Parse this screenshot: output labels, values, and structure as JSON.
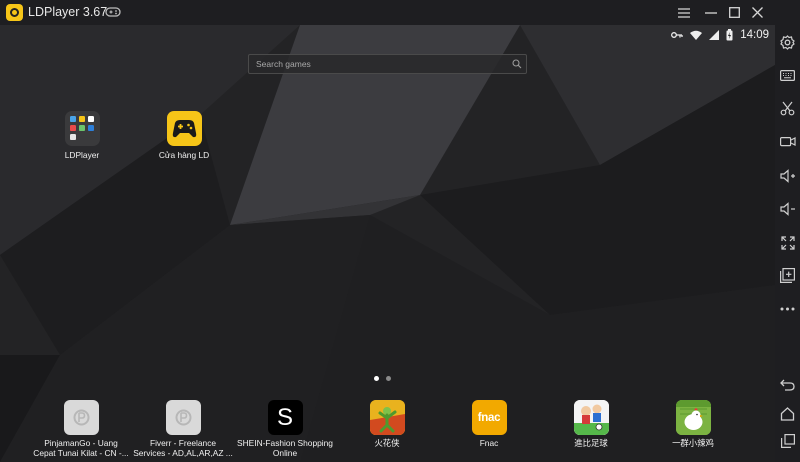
{
  "window": {
    "title": "LDPlayer 3.67"
  },
  "status_bar": {
    "time": "14:09"
  },
  "search": {
    "placeholder": "Search games"
  },
  "desktop_apps": [
    {
      "label": "LDPlayer"
    },
    {
      "label": "Cửa hàng LD"
    }
  ],
  "page_indicator": {
    "pages": 2,
    "current": 1
  },
  "dock_apps": [
    {
      "line1": "PinjamanGo - Uang",
      "line2": "Cepat Tunai Kilat - CN -..."
    },
    {
      "line1": "Fiverr - Freelance",
      "line2": "Services - AD,AL,AR,AZ ..."
    },
    {
      "line1": "SHEIN-Fashion Shopping",
      "line2": "Online"
    },
    {
      "line1": "火花侠",
      "line2": ""
    },
    {
      "line1": "Fnac",
      "line2": ""
    },
    {
      "line1": "進比足球",
      "line2": ""
    },
    {
      "line1": "一群小辣鸡",
      "line2": ""
    }
  ],
  "icons": {
    "shein_letter": "S",
    "fnac_text": "fnac"
  },
  "colors": {
    "accent": "#f6c518",
    "titlebar": "#1e1e21",
    "fnac": "#f2a900"
  }
}
